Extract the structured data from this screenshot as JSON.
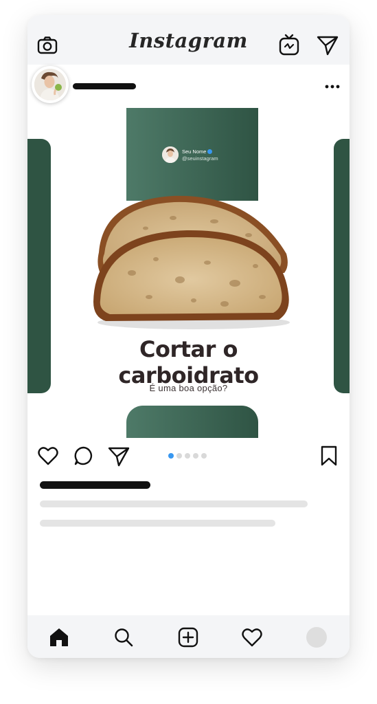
{
  "app": {
    "title": "Instagram"
  },
  "header": {
    "icons": [
      "camera-icon",
      "igtv-icon",
      "direct-message-icon"
    ]
  },
  "post": {
    "creator": {
      "name": "Seu Nome",
      "handle": "@seuinstagram",
      "verified": true
    },
    "headline_line1": "Cortar o",
    "headline_line2": "carboidrato",
    "subheadline": "É uma boa opção?",
    "carousel": {
      "total_slides": 5,
      "current_slide": 1
    },
    "colors": {
      "slide_green": "#2f5443",
      "slide_green_light": "#4e7a68",
      "headline": "#2f2627",
      "active_dot": "#3897f0"
    }
  },
  "actions": {
    "icons": [
      "heart-icon",
      "comment-icon",
      "share-icon",
      "bookmark-icon"
    ]
  },
  "bottom_nav": {
    "items": [
      "home-icon",
      "search-icon",
      "add-post-icon",
      "activity-heart-icon",
      "profile-avatar"
    ]
  }
}
